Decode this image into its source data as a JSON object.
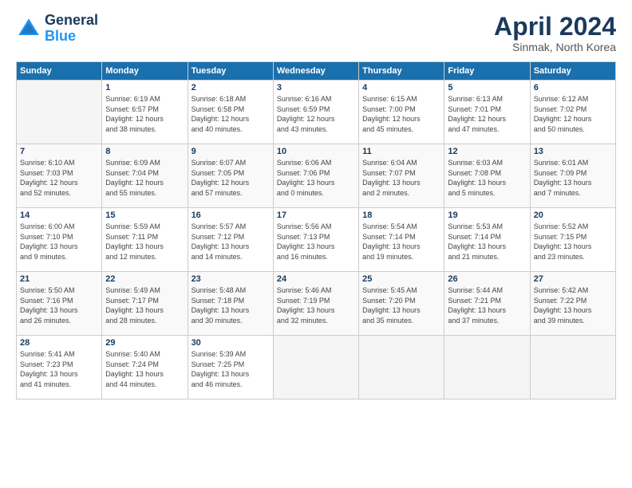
{
  "logo": {
    "line1": "General",
    "line2": "Blue"
  },
  "title": "April 2024",
  "subtitle": "Sinmak, North Korea",
  "days_header": [
    "Sunday",
    "Monday",
    "Tuesday",
    "Wednesday",
    "Thursday",
    "Friday",
    "Saturday"
  ],
  "weeks": [
    [
      {
        "num": "",
        "detail": ""
      },
      {
        "num": "1",
        "detail": "Sunrise: 6:19 AM\nSunset: 6:57 PM\nDaylight: 12 hours\nand 38 minutes."
      },
      {
        "num": "2",
        "detail": "Sunrise: 6:18 AM\nSunset: 6:58 PM\nDaylight: 12 hours\nand 40 minutes."
      },
      {
        "num": "3",
        "detail": "Sunrise: 6:16 AM\nSunset: 6:59 PM\nDaylight: 12 hours\nand 43 minutes."
      },
      {
        "num": "4",
        "detail": "Sunrise: 6:15 AM\nSunset: 7:00 PM\nDaylight: 12 hours\nand 45 minutes."
      },
      {
        "num": "5",
        "detail": "Sunrise: 6:13 AM\nSunset: 7:01 PM\nDaylight: 12 hours\nand 47 minutes."
      },
      {
        "num": "6",
        "detail": "Sunrise: 6:12 AM\nSunset: 7:02 PM\nDaylight: 12 hours\nand 50 minutes."
      }
    ],
    [
      {
        "num": "7",
        "detail": "Sunrise: 6:10 AM\nSunset: 7:03 PM\nDaylight: 12 hours\nand 52 minutes."
      },
      {
        "num": "8",
        "detail": "Sunrise: 6:09 AM\nSunset: 7:04 PM\nDaylight: 12 hours\nand 55 minutes."
      },
      {
        "num": "9",
        "detail": "Sunrise: 6:07 AM\nSunset: 7:05 PM\nDaylight: 12 hours\nand 57 minutes."
      },
      {
        "num": "10",
        "detail": "Sunrise: 6:06 AM\nSunset: 7:06 PM\nDaylight: 13 hours\nand 0 minutes."
      },
      {
        "num": "11",
        "detail": "Sunrise: 6:04 AM\nSunset: 7:07 PM\nDaylight: 13 hours\nand 2 minutes."
      },
      {
        "num": "12",
        "detail": "Sunrise: 6:03 AM\nSunset: 7:08 PM\nDaylight: 13 hours\nand 5 minutes."
      },
      {
        "num": "13",
        "detail": "Sunrise: 6:01 AM\nSunset: 7:09 PM\nDaylight: 13 hours\nand 7 minutes."
      }
    ],
    [
      {
        "num": "14",
        "detail": "Sunrise: 6:00 AM\nSunset: 7:10 PM\nDaylight: 13 hours\nand 9 minutes."
      },
      {
        "num": "15",
        "detail": "Sunrise: 5:59 AM\nSunset: 7:11 PM\nDaylight: 13 hours\nand 12 minutes."
      },
      {
        "num": "16",
        "detail": "Sunrise: 5:57 AM\nSunset: 7:12 PM\nDaylight: 13 hours\nand 14 minutes."
      },
      {
        "num": "17",
        "detail": "Sunrise: 5:56 AM\nSunset: 7:13 PM\nDaylight: 13 hours\nand 16 minutes."
      },
      {
        "num": "18",
        "detail": "Sunrise: 5:54 AM\nSunset: 7:14 PM\nDaylight: 13 hours\nand 19 minutes."
      },
      {
        "num": "19",
        "detail": "Sunrise: 5:53 AM\nSunset: 7:14 PM\nDaylight: 13 hours\nand 21 minutes."
      },
      {
        "num": "20",
        "detail": "Sunrise: 5:52 AM\nSunset: 7:15 PM\nDaylight: 13 hours\nand 23 minutes."
      }
    ],
    [
      {
        "num": "21",
        "detail": "Sunrise: 5:50 AM\nSunset: 7:16 PM\nDaylight: 13 hours\nand 26 minutes."
      },
      {
        "num": "22",
        "detail": "Sunrise: 5:49 AM\nSunset: 7:17 PM\nDaylight: 13 hours\nand 28 minutes."
      },
      {
        "num": "23",
        "detail": "Sunrise: 5:48 AM\nSunset: 7:18 PM\nDaylight: 13 hours\nand 30 minutes."
      },
      {
        "num": "24",
        "detail": "Sunrise: 5:46 AM\nSunset: 7:19 PM\nDaylight: 13 hours\nand 32 minutes."
      },
      {
        "num": "25",
        "detail": "Sunrise: 5:45 AM\nSunset: 7:20 PM\nDaylight: 13 hours\nand 35 minutes."
      },
      {
        "num": "26",
        "detail": "Sunrise: 5:44 AM\nSunset: 7:21 PM\nDaylight: 13 hours\nand 37 minutes."
      },
      {
        "num": "27",
        "detail": "Sunrise: 5:42 AM\nSunset: 7:22 PM\nDaylight: 13 hours\nand 39 minutes."
      }
    ],
    [
      {
        "num": "28",
        "detail": "Sunrise: 5:41 AM\nSunset: 7:23 PM\nDaylight: 13 hours\nand 41 minutes."
      },
      {
        "num": "29",
        "detail": "Sunrise: 5:40 AM\nSunset: 7:24 PM\nDaylight: 13 hours\nand 44 minutes."
      },
      {
        "num": "30",
        "detail": "Sunrise: 5:39 AM\nSunset: 7:25 PM\nDaylight: 13 hours\nand 46 minutes."
      },
      {
        "num": "",
        "detail": ""
      },
      {
        "num": "",
        "detail": ""
      },
      {
        "num": "",
        "detail": ""
      },
      {
        "num": "",
        "detail": ""
      }
    ]
  ]
}
